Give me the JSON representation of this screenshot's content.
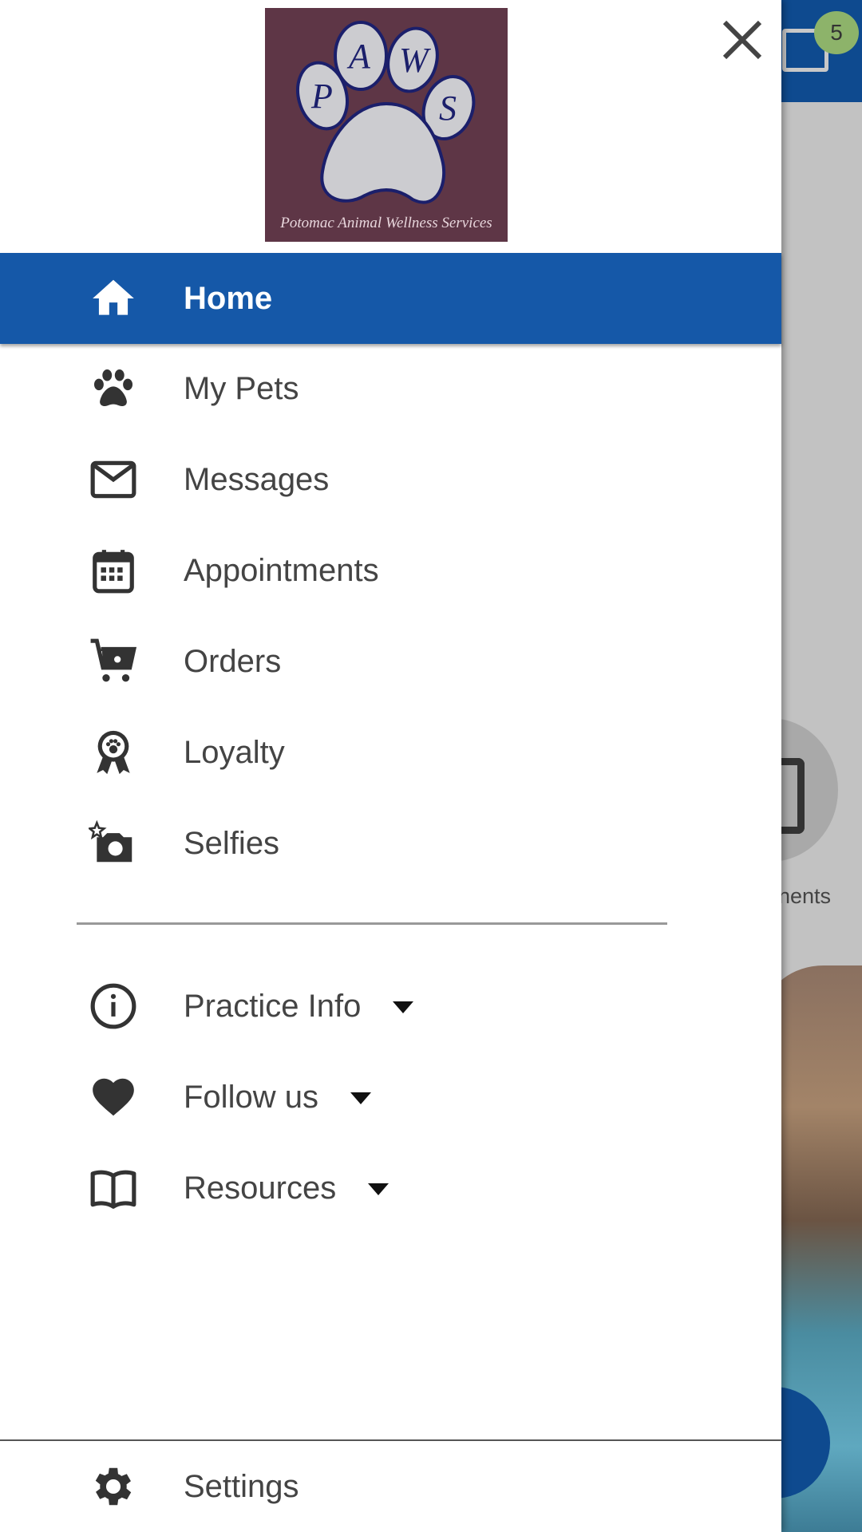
{
  "background": {
    "notification_count": "5",
    "partial_label": "nents",
    "accent": "#0e4a8f"
  },
  "drawer": {
    "logo": {
      "letters": "PAWS",
      "tagline": "Potomac Animal Wellness Services"
    },
    "items": [
      {
        "label": "Home",
        "icon": "home-icon",
        "active": true
      },
      {
        "label": "My Pets",
        "icon": "paw-icon"
      },
      {
        "label": "Messages",
        "icon": "mail-icon"
      },
      {
        "label": "Appointments",
        "icon": "calendar-icon"
      },
      {
        "label": "Orders",
        "icon": "cart-icon"
      },
      {
        "label": "Loyalty",
        "icon": "award-icon"
      },
      {
        "label": "Selfies",
        "icon": "camera-icon"
      }
    ],
    "sections": [
      {
        "label": "Practice Info",
        "icon": "info-icon"
      },
      {
        "label": "Follow us",
        "icon": "heart-icon"
      },
      {
        "label": "Resources",
        "icon": "book-icon"
      }
    ],
    "settings": {
      "label": "Settings",
      "icon": "gear-icon"
    },
    "active_color": "#1558a8"
  }
}
